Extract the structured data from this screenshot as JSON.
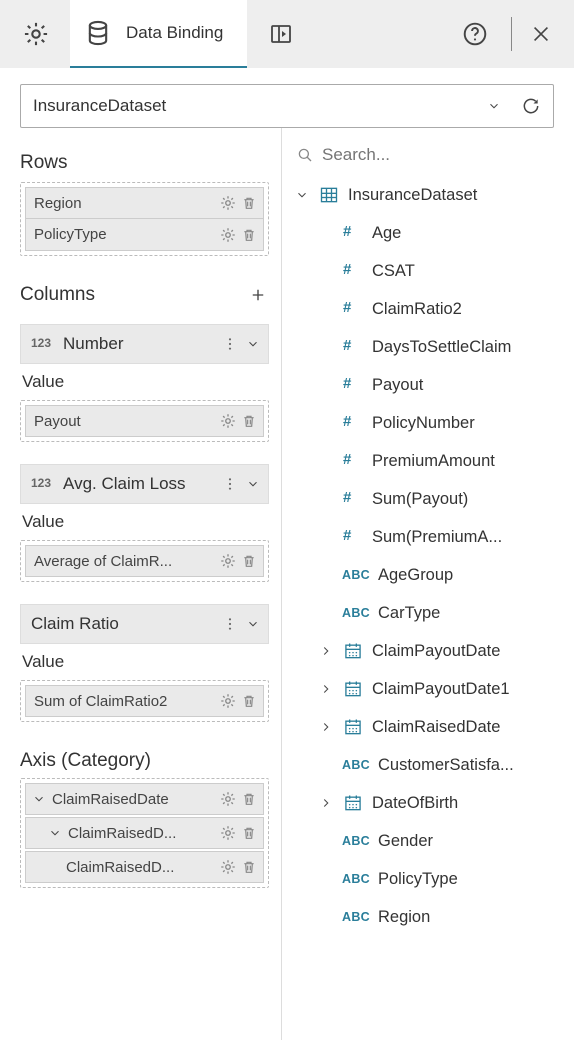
{
  "toolbar": {
    "tab_label": "Data Binding"
  },
  "dataset": {
    "name": "InsuranceDataset"
  },
  "sections": {
    "rows_title": "Rows",
    "columns_title": "Columns",
    "value_label": "Value",
    "axis_label": "Axis (Category)"
  },
  "rows": [
    {
      "label": "Region"
    },
    {
      "label": "PolicyType"
    }
  ],
  "column_groups": [
    {
      "prefix": "123",
      "label": "Number",
      "value_chips": [
        {
          "label": "Payout"
        }
      ]
    },
    {
      "prefix": "123",
      "label": "Avg. Claim Loss",
      "value_chips": [
        {
          "label": "Average of ClaimR..."
        }
      ]
    },
    {
      "prefix": "",
      "label": "Claim Ratio",
      "value_chips": [
        {
          "label": "Sum of ClaimRatio2"
        }
      ]
    }
  ],
  "axis": [
    {
      "level": 0,
      "label": "ClaimRaisedDate"
    },
    {
      "level": 1,
      "label": "ClaimRaisedD..."
    },
    {
      "level": 2,
      "label": "ClaimRaisedD..."
    }
  ],
  "search": {
    "placeholder": "Search..."
  },
  "tree": {
    "root": "InsuranceDataset",
    "children": [
      {
        "type": "num",
        "label": "Age"
      },
      {
        "type": "num",
        "label": "CSAT"
      },
      {
        "type": "num",
        "label": "ClaimRatio2"
      },
      {
        "type": "num",
        "label": "DaysToSettleClaim"
      },
      {
        "type": "num",
        "label": "Payout"
      },
      {
        "type": "num",
        "label": "PolicyNumber"
      },
      {
        "type": "num",
        "label": "PremiumAmount"
      },
      {
        "type": "num",
        "label": "Sum(Payout)"
      },
      {
        "type": "num",
        "label": "Sum(PremiumA..."
      },
      {
        "type": "abc",
        "label": "AgeGroup"
      },
      {
        "type": "abc",
        "label": "CarType"
      },
      {
        "type": "date",
        "expandable": true,
        "label": "ClaimPayoutDate"
      },
      {
        "type": "date",
        "expandable": true,
        "label": "ClaimPayoutDate1"
      },
      {
        "type": "date",
        "expandable": true,
        "label": "ClaimRaisedDate"
      },
      {
        "type": "abc",
        "label": "CustomerSatisfa..."
      },
      {
        "type": "date",
        "expandable": true,
        "label": "DateOfBirth"
      },
      {
        "type": "abc",
        "label": "Gender"
      },
      {
        "type": "abc",
        "label": "PolicyType"
      },
      {
        "type": "abc",
        "label": "Region"
      }
    ]
  }
}
